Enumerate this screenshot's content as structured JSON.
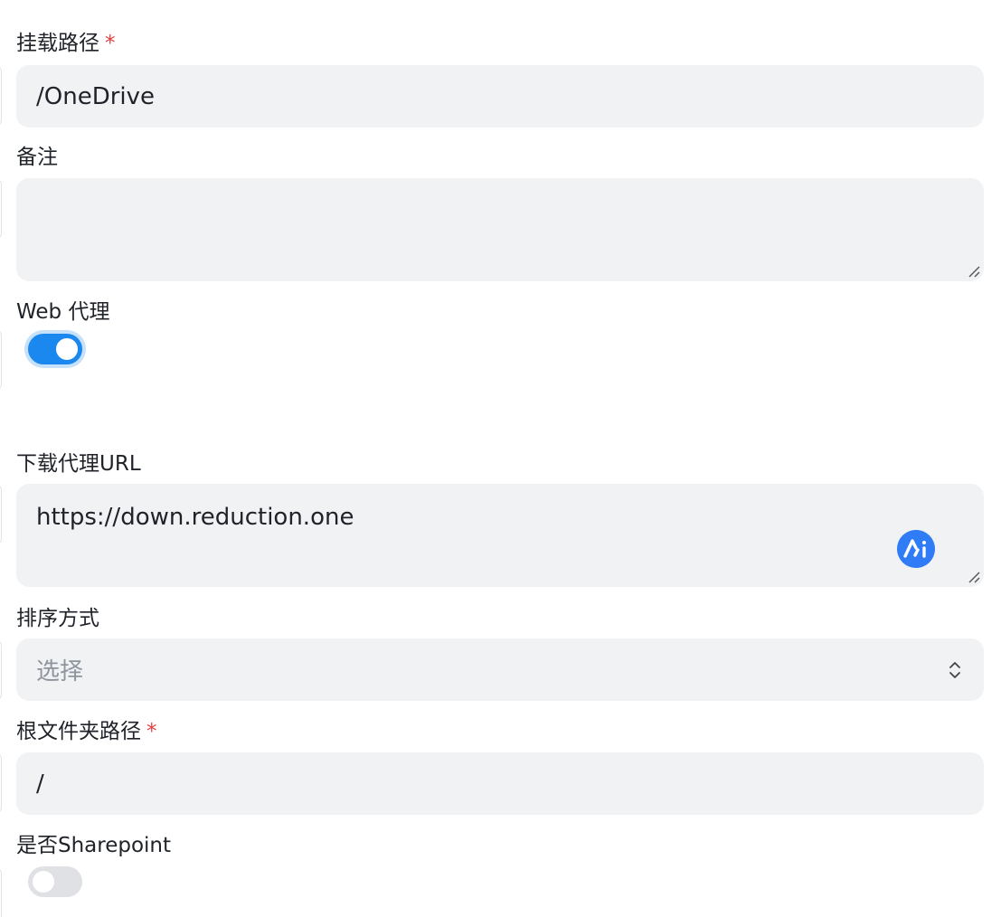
{
  "mount_path": {
    "label": "挂载路径",
    "required_mark": "*",
    "value": "/OneDrive"
  },
  "remark": {
    "label": "备注",
    "value": ""
  },
  "web_proxy": {
    "label": "Web 代理",
    "enabled": true
  },
  "download_proxy_url": {
    "label": "下载代理URL",
    "value": "https://down.reduction.one"
  },
  "order_by": {
    "label": "排序方式",
    "placeholder": "选择"
  },
  "root_folder_path": {
    "label": "根文件夹路径",
    "required_mark": "*",
    "value": "/"
  },
  "is_sharepoint": {
    "label": "是否Sharepoint",
    "enabled": false
  },
  "icons": {
    "resize": "resize-handle-icon",
    "select": "chevron-up-down-icon",
    "assistant": "assistant-badge-icon"
  },
  "colors": {
    "accent": "#1a88ef",
    "required": "#e53e3e",
    "field_bg": "#f1f2f4"
  }
}
